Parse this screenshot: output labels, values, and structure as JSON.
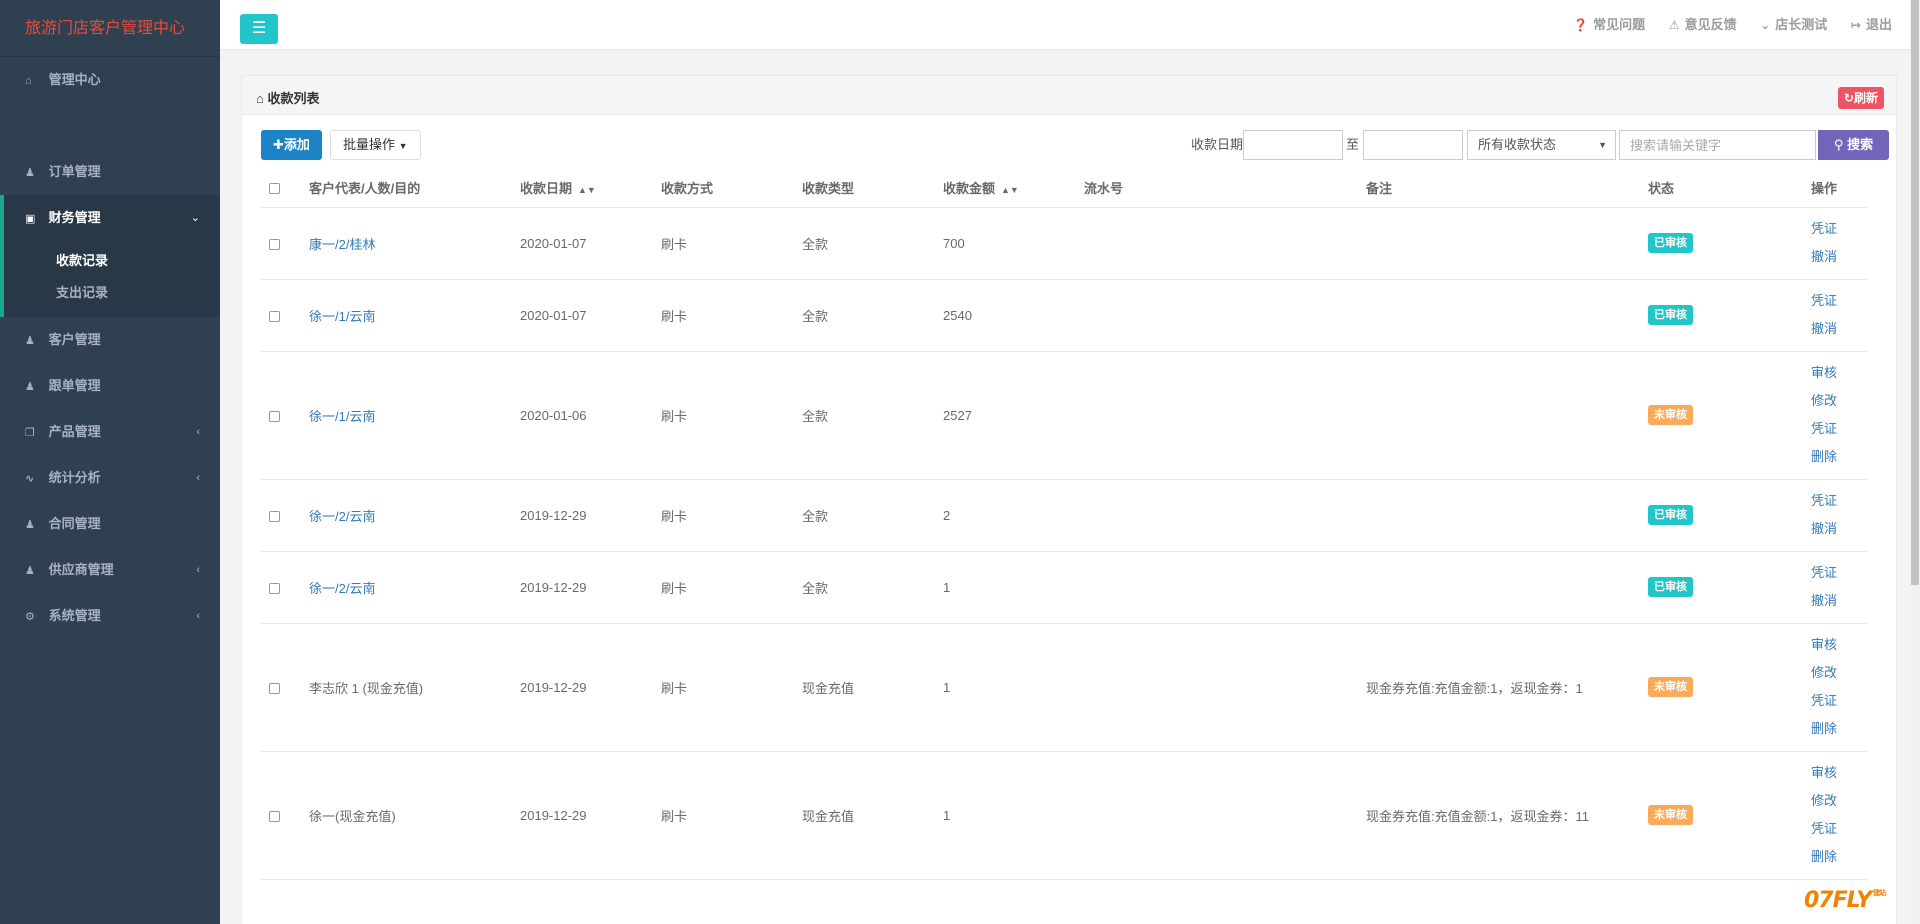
{
  "brand": "旅游门店客户管理中心",
  "sidebar": {
    "items": [
      {
        "label": "管理中心",
        "icon": "home-icon"
      },
      {
        "label": "订单管理",
        "icon": "user-icon"
      },
      {
        "label": "财务管理",
        "icon": "money-icon",
        "expanded": true
      },
      {
        "label": "客户管理",
        "icon": "user-icon"
      },
      {
        "label": "跟单管理",
        "icon": "user-icon"
      },
      {
        "label": "产品管理",
        "icon": "cube-icon"
      },
      {
        "label": "统计分析",
        "icon": "line-chart-icon"
      },
      {
        "label": "合同管理",
        "icon": "user-icon"
      },
      {
        "label": "供应商管理",
        "icon": "users-icon"
      },
      {
        "label": "系统管理",
        "icon": "cogs-icon"
      }
    ],
    "sub_items": [
      "收款记录",
      "支出记录"
    ]
  },
  "topbar": {
    "links": [
      {
        "label": "常见问题",
        "icon": "question-circle-icon"
      },
      {
        "label": "意见反馈",
        "icon": "warning-icon"
      },
      {
        "label": "店长测试",
        "icon": "chevron-down-icon"
      },
      {
        "label": "退出",
        "icon": "sign-out-icon"
      }
    ]
  },
  "panel": {
    "title": "收款列表",
    "refresh_label": "刷新"
  },
  "toolbar": {
    "add_label": "添加",
    "batch_label": "批量操作",
    "date_label": "收款日期",
    "to_label": "至",
    "status_selected": "所有收款状态",
    "search_placeholder": "搜索请输关键字",
    "search_label": "搜索"
  },
  "table": {
    "headers": [
      "客户代表/人数/目的",
      "收款日期",
      "收款方式",
      "收款类型",
      "收款金额",
      "流水号",
      "备注",
      "状态",
      "操作"
    ],
    "rows": [
      {
        "customer": "康一/2/桂林",
        "link": true,
        "date": "2020-01-07",
        "method": "刷卡",
        "type": "全款",
        "amount": "700",
        "serial": "",
        "note": "",
        "status": "已审核",
        "ops": [
          "凭证",
          "撤消"
        ]
      },
      {
        "customer": "徐一/1/云南",
        "link": true,
        "date": "2020-01-07",
        "method": "刷卡",
        "type": "全款",
        "amount": "2540",
        "serial": "",
        "note": "",
        "status": "已审核",
        "ops": [
          "凭证",
          "撤消"
        ]
      },
      {
        "customer": "徐一/1/云南",
        "link": true,
        "date": "2020-01-06",
        "method": "刷卡",
        "type": "全款",
        "amount": "2527",
        "serial": "",
        "note": "",
        "status": "未审核",
        "ops": [
          "审核",
          "修改",
          "凭证",
          "删除"
        ]
      },
      {
        "customer": "徐一/2/云南",
        "link": true,
        "date": "2019-12-29",
        "method": "刷卡",
        "type": "全款",
        "amount": "2",
        "serial": "",
        "note": "",
        "status": "已审核",
        "ops": [
          "凭证",
          "撤消"
        ]
      },
      {
        "customer": "徐一/2/云南",
        "link": true,
        "date": "2019-12-29",
        "method": "刷卡",
        "type": "全款",
        "amount": "1",
        "serial": "",
        "note": "",
        "status": "已审核",
        "ops": [
          "凭证",
          "撤消"
        ]
      },
      {
        "customer": "李志欣 1 (现金充值)",
        "link": false,
        "date": "2019-12-29",
        "method": "刷卡",
        "type": "现金充值",
        "amount": "1",
        "serial": "",
        "note": "现金券充值:充值金额:1，返现金券：1",
        "status": "未审核",
        "ops": [
          "审核",
          "修改",
          "凭证",
          "删除"
        ]
      },
      {
        "customer": "徐一(现金充值)",
        "link": false,
        "date": "2019-12-29",
        "method": "刷卡",
        "type": "现金充值",
        "amount": "1",
        "serial": "",
        "note": "现金券充值:充值金额:1，返现金券：11",
        "status": "未审核",
        "ops": [
          "审核",
          "修改",
          "凭证",
          "删除"
        ]
      }
    ]
  },
  "watermark": {
    "main": "07FLY",
    "small": "建站"
  }
}
